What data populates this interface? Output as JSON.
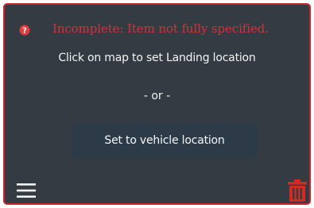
{
  "status": {
    "message": "Incomplete: Item not fully specified.",
    "icon": "error-question-icon",
    "color": "#d0333a"
  },
  "instruction": "Click on map to set Landing location",
  "separator": "- or -",
  "actions": {
    "set_vehicle_location_label": "Set to vehicle location"
  },
  "toolbar": {
    "menu_icon": "hamburger-menu-icon",
    "delete_icon": "trash-icon"
  },
  "colors": {
    "panel_background": "#353b42",
    "panel_border": "#c6262c",
    "button_background": "#2d3a48",
    "text": "#f2f4f6",
    "delete_icon": "#d42a22"
  }
}
